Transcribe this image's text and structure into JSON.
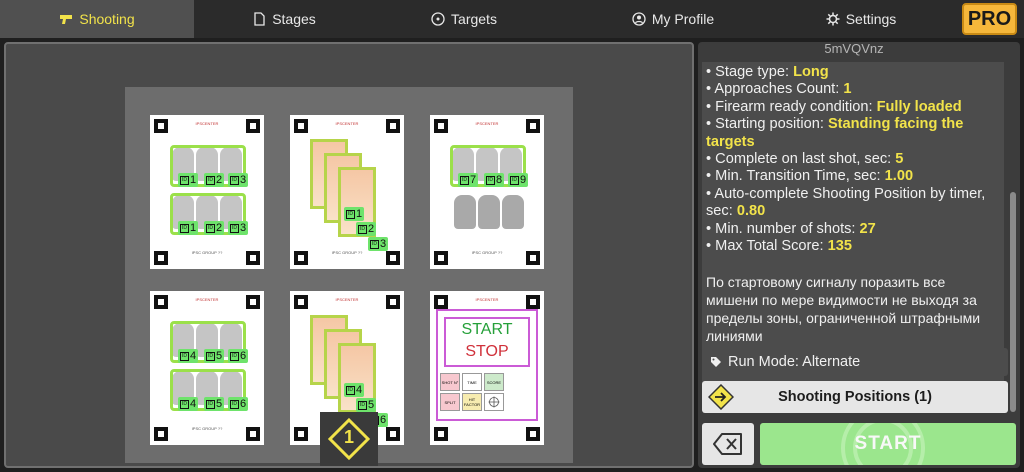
{
  "tabs": [
    {
      "label": "Shooting",
      "icon": "pistol-icon"
    },
    {
      "label": "Stages",
      "icon": "document-icon"
    },
    {
      "label": "Targets",
      "icon": "target-icon"
    },
    {
      "label": "My Profile",
      "icon": "profile-icon"
    },
    {
      "label": "Settings",
      "icon": "gear-icon"
    }
  ],
  "pro_label": "PRO",
  "stage": {
    "code": "5mVQVnz",
    "info": [
      {
        "label": "• Stage type: ",
        "value": "Long"
      },
      {
        "label": "• Approaches Count: ",
        "value": "1"
      },
      {
        "label": "• Firearm ready condition: ",
        "value": "Fully loaded"
      },
      {
        "label": "• Starting position: ",
        "value": "Standing facing the targets"
      },
      {
        "label": "• Complete on last shot, sec: ",
        "value": "5"
      },
      {
        "label": "• Min. Transition Time, sec: ",
        "value": "1.00"
      },
      {
        "label": "• Auto-complete Shooting Position by timer, sec: ",
        "value": "0.80"
      },
      {
        "label": "• Min. number of shots: ",
        "value": "27"
      },
      {
        "label": "• Max Total Score: ",
        "value": "135"
      }
    ],
    "description": "По стартовому сигналу поразить все мишени по мере видимости не выходя за пределы зоны, ограниченной штрафными линиями",
    "run_mode": "Run Mode: Alternate",
    "shooting_positions": "Shooting Positions (1)",
    "start_label": "START"
  },
  "cards": {
    "header": "IPSCENTER",
    "footer": "IPSC GROUP ??",
    "card1_tags": [
      "1",
      "2",
      "3",
      "1",
      "2",
      "3"
    ],
    "card2_tags": [
      "1",
      "2",
      "3"
    ],
    "card3_tags": [
      "7",
      "8",
      "9"
    ],
    "card4_tags": [
      "4",
      "5",
      "6",
      "4",
      "5",
      "6"
    ],
    "card5_tags": [
      "4",
      "5",
      "6"
    ],
    "startcard": {
      "start": "START",
      "stop": "STOP",
      "cells": [
        "SHOT N°",
        "TIME",
        "SCORE",
        "SPLIT",
        "HIT FACTOR",
        ""
      ]
    }
  },
  "position_number": "1",
  "colors": {
    "accent_yellow": "#f2e34a",
    "pro_orange": "#f5b73b",
    "tag_green": "#6ee36b",
    "start_green": "#9be68d"
  }
}
